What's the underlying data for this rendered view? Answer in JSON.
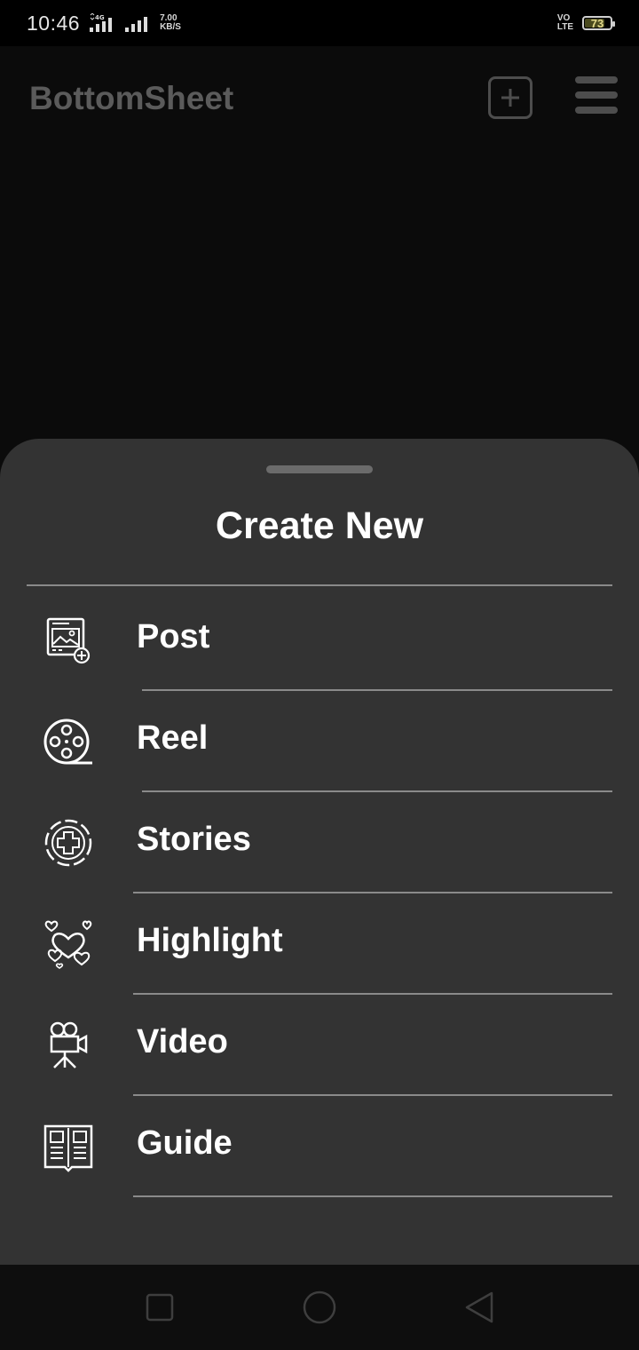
{
  "status_bar": {
    "time": "10:46",
    "network_speed": "7.00\nKB/S",
    "volte": "VO\nLTE",
    "battery": "73"
  },
  "app_bar": {
    "title": "BottomSheet",
    "add_icon": "plus-square-icon",
    "menu_icon": "hamburger-icon"
  },
  "sheet": {
    "title": "Create New",
    "items": [
      {
        "label": "Post",
        "icon": "image-post-icon"
      },
      {
        "label": "Reel",
        "icon": "film-reel-icon"
      },
      {
        "label": "Stories",
        "icon": "story-plus-icon"
      },
      {
        "label": "Highlight",
        "icon": "hearts-icon"
      },
      {
        "label": "Video",
        "icon": "video-camera-icon"
      },
      {
        "label": "Guide",
        "icon": "book-icon"
      }
    ]
  },
  "nav_bar": {
    "recents_icon": "square-icon",
    "home_icon": "circle-icon",
    "back_icon": "triangle-back-icon"
  }
}
